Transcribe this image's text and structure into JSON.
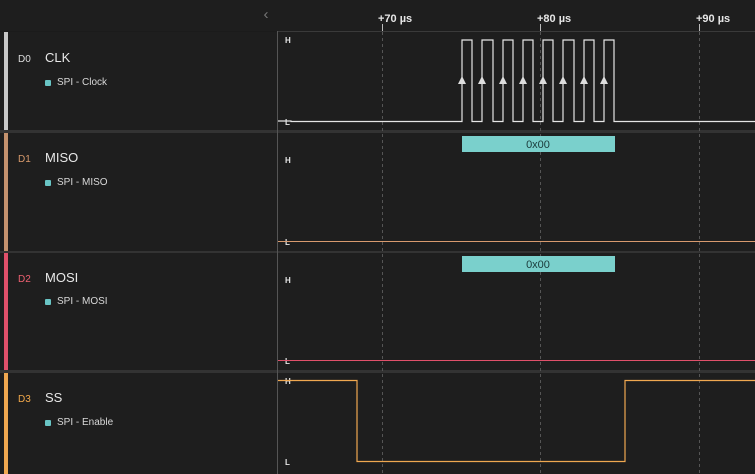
{
  "timeline": {
    "labels": [
      "+70 µs",
      "+80 µs",
      "+90 µs"
    ]
  },
  "channels": [
    {
      "index": "D0",
      "name": "CLK",
      "analyzer": "SPI - Clock",
      "color": "#c8c8c8",
      "idx_color": "#dddddd",
      "high": "H",
      "low": "L"
    },
    {
      "index": "D1",
      "name": "MISO",
      "analyzer": "SPI - MISO",
      "color": "#c4926e",
      "idx_color": "#d99a6c",
      "high": "H",
      "low": "L",
      "decoded": "0x00"
    },
    {
      "index": "D2",
      "name": "MOSI",
      "analyzer": "SPI - MOSI",
      "color": "#e0506a",
      "idx_color": "#ee6070",
      "high": "H",
      "low": "L",
      "decoded": "0x00"
    },
    {
      "index": "D3",
      "name": "SS",
      "analyzer": "SPI - Enable",
      "color": "#f0a850",
      "idx_color": "#f2a84a",
      "high": "H",
      "low": "L"
    }
  ]
}
